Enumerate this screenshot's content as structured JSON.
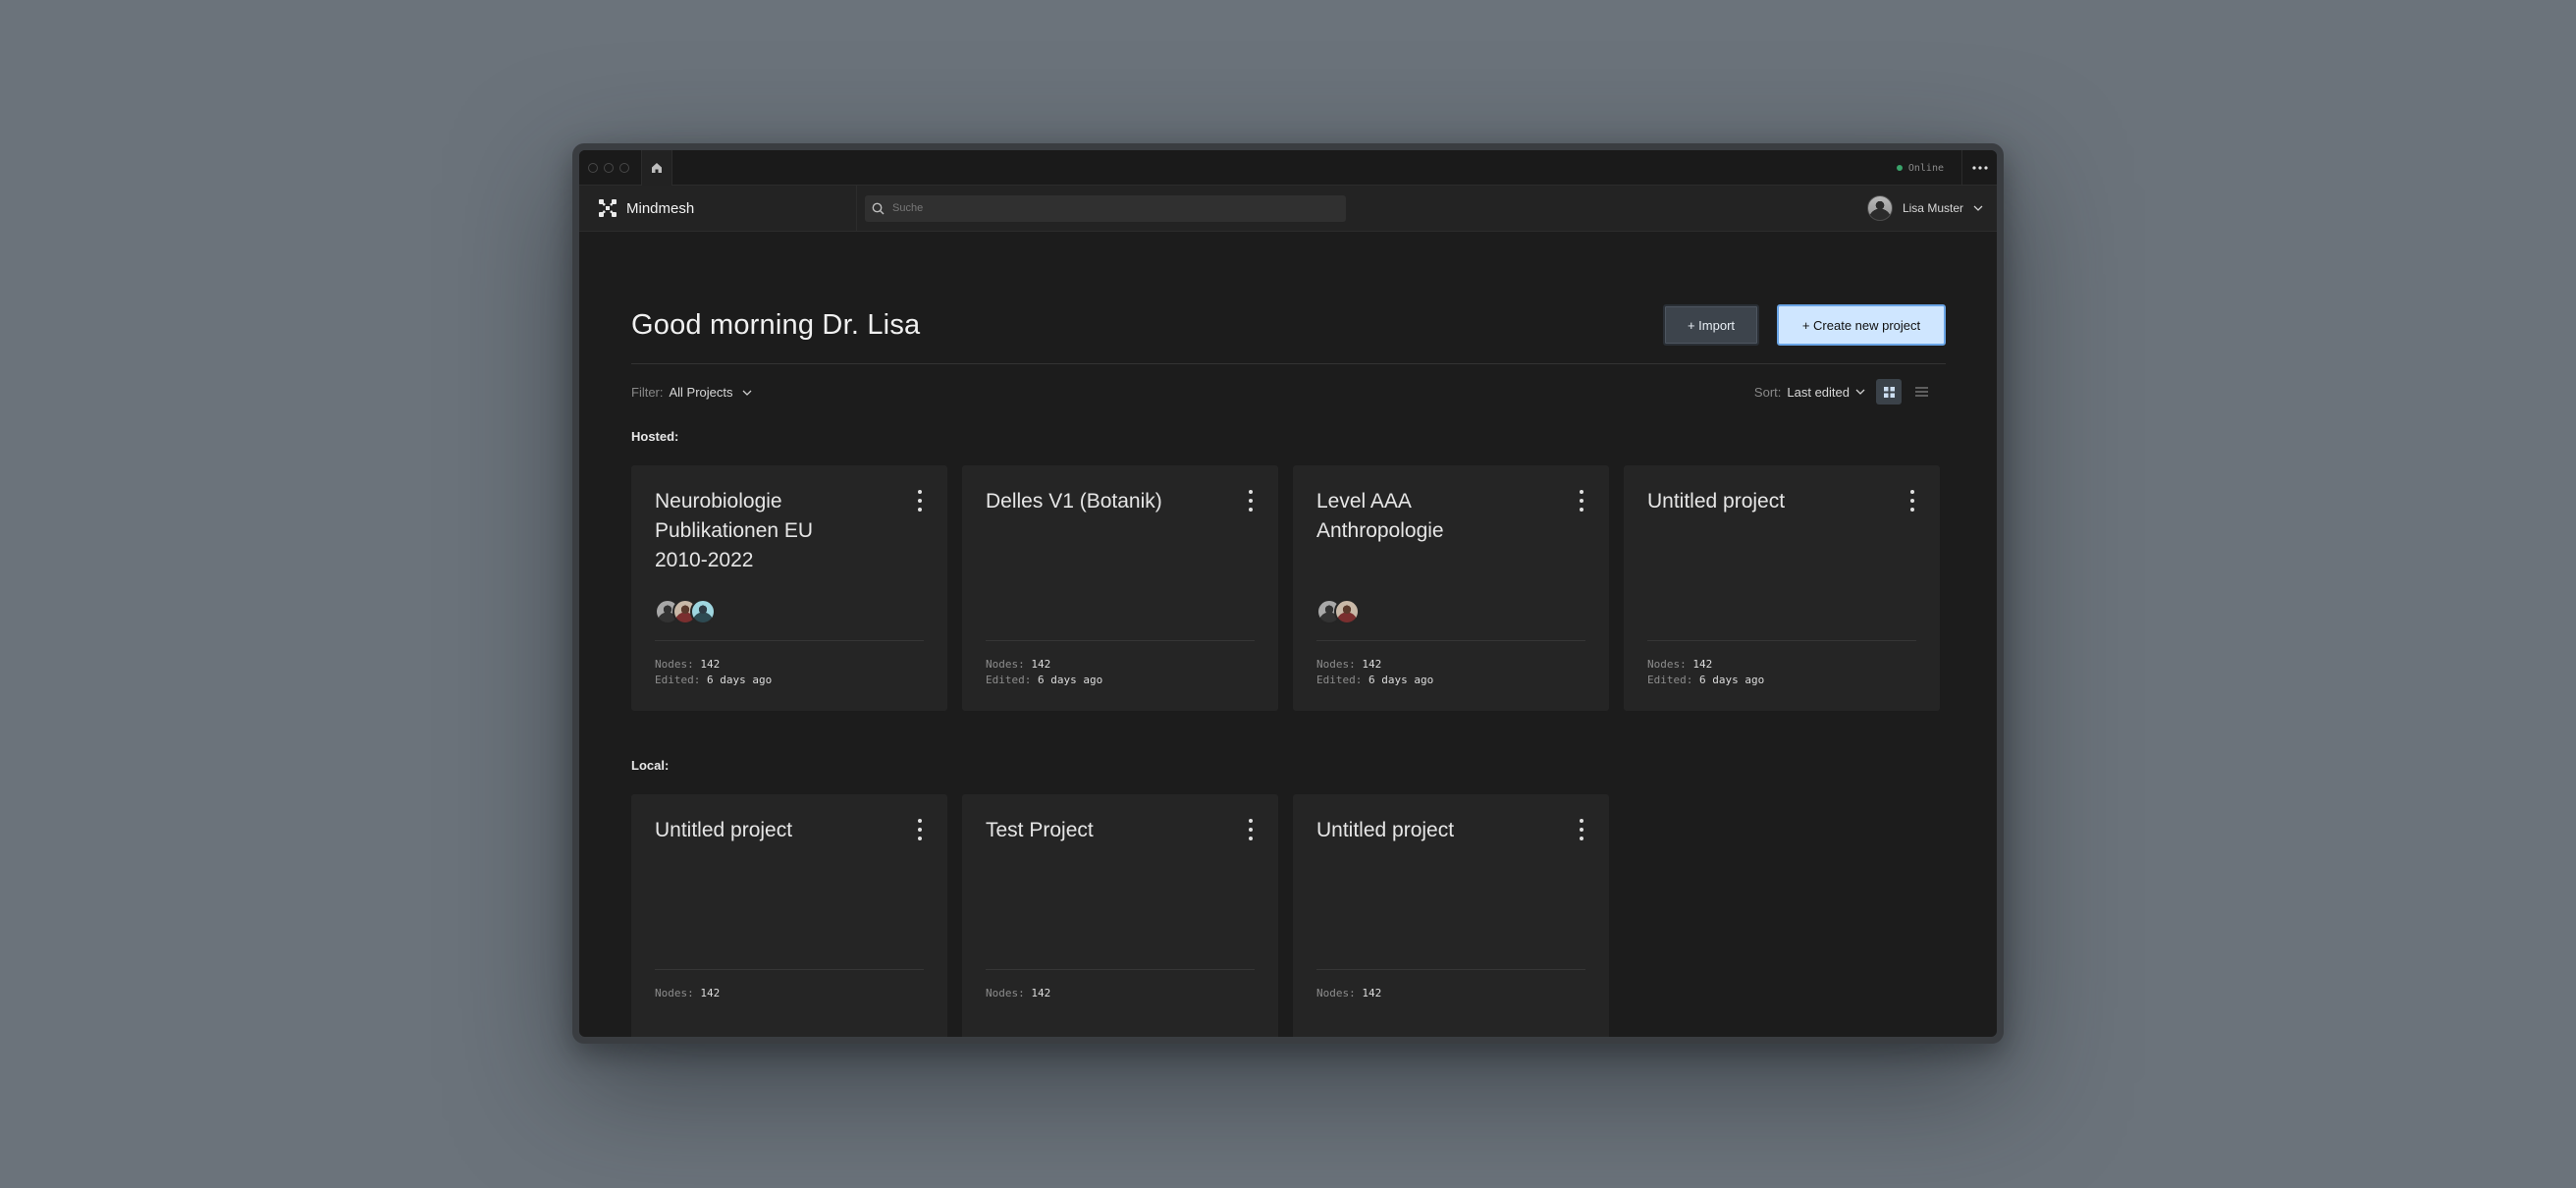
{
  "titlebar": {
    "status_text": "Online",
    "status_color": "#3aa36a"
  },
  "appbar": {
    "brand_name": "Mindmesh",
    "search_placeholder": "Suche",
    "user_name": "Lisa Muster"
  },
  "header": {
    "greeting": "Good morning Dr. Lisa",
    "import_label": "+ Import",
    "create_label": "+ Create new project"
  },
  "toolbar": {
    "filter_label": "Filter:",
    "filter_value": "All Projects",
    "sort_label": "Sort:",
    "sort_value": "Last edited"
  },
  "meta_labels": {
    "nodes": "Nodes:",
    "edited": "Edited:"
  },
  "hosted": {
    "label": "Hosted:",
    "projects": [
      {
        "title": "Neurobiologie Publikationen EU 2010-2022",
        "nodes": "142",
        "edited": "6 days ago"
      },
      {
        "title": "Delles V1 (Botanik)",
        "nodes": "142",
        "edited": "6 days ago"
      },
      {
        "title": "Level AAA Anthropologie",
        "nodes": "142",
        "edited": "6 days ago"
      },
      {
        "title": "Untitled project",
        "nodes": "142",
        "edited": "6 days ago"
      }
    ]
  },
  "local": {
    "label": "Local:",
    "projects": [
      {
        "title": "Untitled project",
        "nodes": "142"
      },
      {
        "title": "Test Project",
        "nodes": "142"
      },
      {
        "title": "Untitled project",
        "nodes": "142"
      }
    ]
  },
  "colors": {
    "background": "#6b737b",
    "app_background": "#1c1c1c",
    "card_background": "#252525",
    "primary_button": "#cfe6ff",
    "primary_border": "#6aa5e6"
  }
}
